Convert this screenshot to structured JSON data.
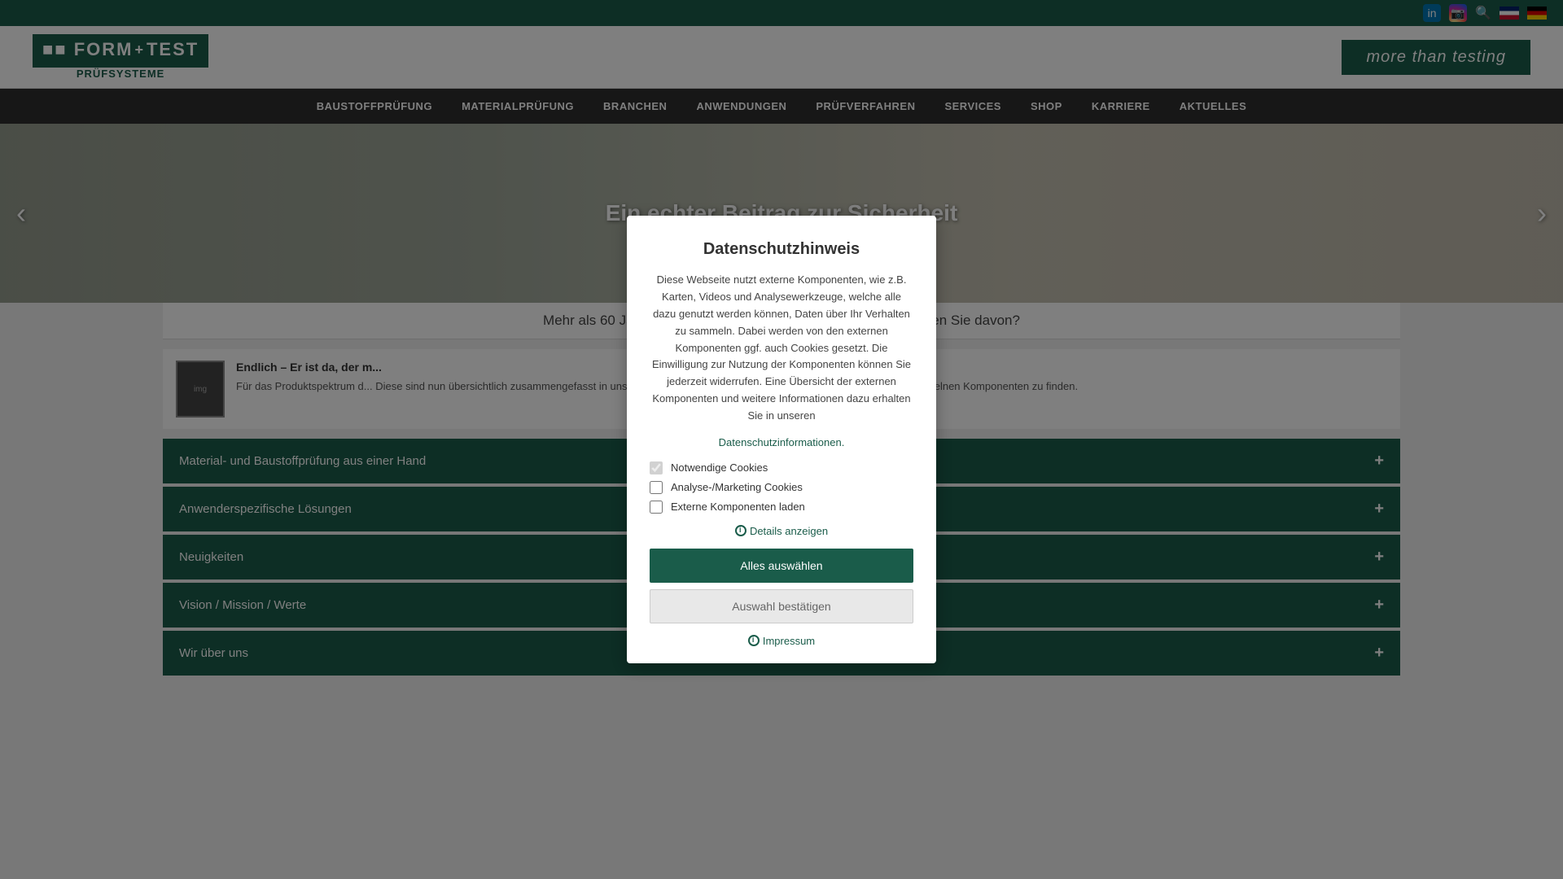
{
  "topbar": {
    "icons": [
      "linkedin",
      "instagram"
    ],
    "search_label": "search",
    "lang_en": "EN",
    "lang_de": "DE"
  },
  "header": {
    "logo_main": "FORM+TEST",
    "logo_sub": "PRÜFSYSTEME",
    "tagline": "more than testing"
  },
  "nav": {
    "items": [
      "BAUSTOFFPRÜFUNG",
      "MATERIALPRÜFUNG",
      "BRANCHEN",
      "ANWENDUNGEN",
      "PRÜFVERFAHREN",
      "SERVICES",
      "SHOP",
      "KARRIERE",
      "AKTUELLES"
    ]
  },
  "hero": {
    "slide_text": "Ein echter Beitrag zur Sicherheit",
    "prev_label": "‹",
    "next_label": "›"
  },
  "promo": {
    "text": "Mehr als 60 Jahre Erfahrung in Materialprüfung – wann profitieren Sie davon?"
  },
  "news": {
    "title": "Endlich – Er ist da, der m...",
    "description": "Für das Produktspektrum d... Diese sind nun übersichtlich zusammengefasst in unserem neuen Blätterkatal... Bauteilprüfung auch Detailinfos zu einzelnen Komponenten zu finden."
  },
  "accordion": {
    "items": [
      "Material- und Baustoffprüfung aus einer Hand",
      "Anwenderspezifische Lösungen",
      "Neuigkeiten",
      "Vision / Mission / Werte",
      "Wir über uns"
    ]
  },
  "modal": {
    "title": "Datenschutzhinweis",
    "body": "Diese Webseite nutzt externe Komponenten, wie z.B. Karten, Videos und Analysewerkzeuge, welche alle dazu genutzt werden können, Daten über Ihr Verhalten zu sammeln. Dabei werden von den externen Komponenten ggf. auch Cookies gesetzt. Die Einwilligung zur Nutzung der Komponenten können Sie jederzeit widerrufen. Eine Übersicht der externen Komponenten und weitere Informationen dazu erhalten Sie in unseren",
    "datenschutz_link": "Datenschutzinformationen.",
    "cookies": [
      {
        "label": "Notwendige Cookies",
        "checked": true,
        "disabled": true
      },
      {
        "label": "Analyse-/Marketing Cookies",
        "checked": false,
        "disabled": false
      },
      {
        "label": "Externe Komponenten laden",
        "checked": false,
        "disabled": false
      }
    ],
    "details_label": "Details anzeigen",
    "btn_accept_all": "Alles auswählen",
    "btn_confirm": "Auswahl bestätigen",
    "impressum_label": "Impressum"
  }
}
